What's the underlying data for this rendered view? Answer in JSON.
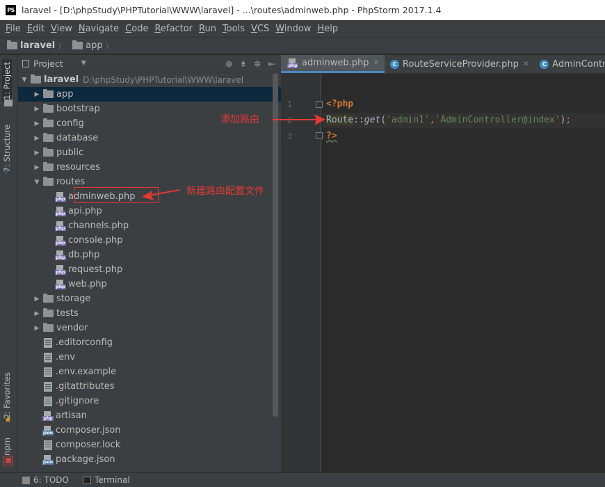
{
  "window": {
    "title": "laravel - [D:\\phpStudy\\PHPTutorial\\WWW\\laravel] - ...\\routes\\adminweb.php - PhpStorm 2017.1.4",
    "logo_text": "PS"
  },
  "menu": [
    {
      "mn": "F",
      "rest": "ile"
    },
    {
      "mn": "E",
      "rest": "dit"
    },
    {
      "mn": "V",
      "rest": "iew"
    },
    {
      "mn": "N",
      "rest": "avigate"
    },
    {
      "mn": "C",
      "rest": "ode"
    },
    {
      "mn": "R",
      "rest": "efactor"
    },
    {
      "mn": "R",
      "rest": "un"
    },
    {
      "mn": "T",
      "rest": "ools"
    },
    {
      "mn": "V",
      "rest": "CS"
    },
    {
      "mn": "W",
      "rest": "indow"
    },
    {
      "mn": "H",
      "rest": "elp"
    }
  ],
  "breadcrumb": [
    "laravel",
    "app"
  ],
  "sidebar_tabs": {
    "project": "1: Project",
    "structure": "7: Structure",
    "favorites": "2: Favorites",
    "npm": "npm"
  },
  "project": {
    "header": "Project",
    "root_name": "laravel",
    "root_path": "D:\\phpStudy\\PHPTutorial\\WWW\\laravel",
    "folders_top": [
      "app",
      "bootstrap",
      "config",
      "database",
      "public",
      "resources",
      "routes"
    ],
    "routes_files": [
      "adminweb.php",
      "api.php",
      "channels.php",
      "console.php",
      "db.php",
      "request.php",
      "web.php"
    ],
    "folders_bottom": [
      "storage",
      "tests",
      "vendor"
    ],
    "root_files": [
      {
        "name": ".editorconfig",
        "kind": "text"
      },
      {
        "name": ".env",
        "kind": "text"
      },
      {
        "name": ".env.example",
        "kind": "text"
      },
      {
        "name": ".gitattributes",
        "kind": "text"
      },
      {
        "name": ".gitignore",
        "kind": "text"
      },
      {
        "name": "artisan",
        "kind": "php"
      },
      {
        "name": "composer.json",
        "kind": "json"
      },
      {
        "name": "composer.lock",
        "kind": "text"
      },
      {
        "name": "package.json",
        "kind": "json"
      }
    ]
  },
  "tabs": [
    {
      "label": "adminweb.php",
      "icon": "php"
    },
    {
      "label": "RouteServiceProvider.php",
      "icon": "class"
    },
    {
      "label": "AdminController.p",
      "icon": "class"
    }
  ],
  "editor": {
    "line_numbers": [
      "1",
      "2",
      "3"
    ],
    "line1": "<?php",
    "line2": {
      "cls": "Route",
      "op": "::",
      "fn": "get",
      "p1": "(",
      "s1": "'admin1'",
      "comma": ",",
      "s2": "'AdminController@index'",
      "p2": ")",
      "semi": ";"
    },
    "line3": "?>"
  },
  "annotations": {
    "add_route": "添加路由",
    "new_route_file": "新建路由配置文件"
  },
  "statusbar": {
    "todo": "6: TODO",
    "terminal": "Terminal"
  },
  "colors": {
    "annotation_red": "#e53935",
    "selection": "#0d293e",
    "tab_underline": "#4a88c7",
    "php_keyword": "#cc7832",
    "string": "#6a8759"
  }
}
